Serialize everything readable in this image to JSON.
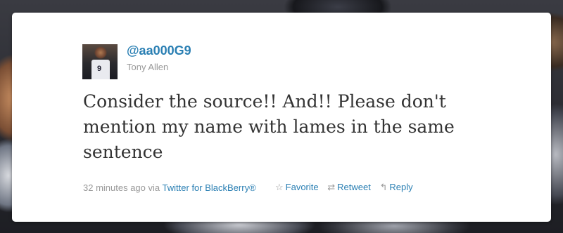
{
  "tweet": {
    "handle": "@aa000G9",
    "name": "Tony Allen",
    "avatar_jersey_number": "9",
    "text": "Consider the source!! And!! Please don't mention my name with lames in the same sentence",
    "timestamp": "32 minutes ago",
    "via_label": "via",
    "source": "Twitter for BlackBerry®"
  },
  "actions": {
    "favorite_label": "Favorite",
    "retweet_label": "Retweet",
    "reply_label": "Reply"
  },
  "icons": {
    "favorite": "star-outline-icon",
    "retweet": "retweet-icon",
    "reply": "reply-arrow-icon"
  },
  "colors": {
    "link": "#2a7fb3",
    "muted": "#999999",
    "text": "#333333"
  }
}
